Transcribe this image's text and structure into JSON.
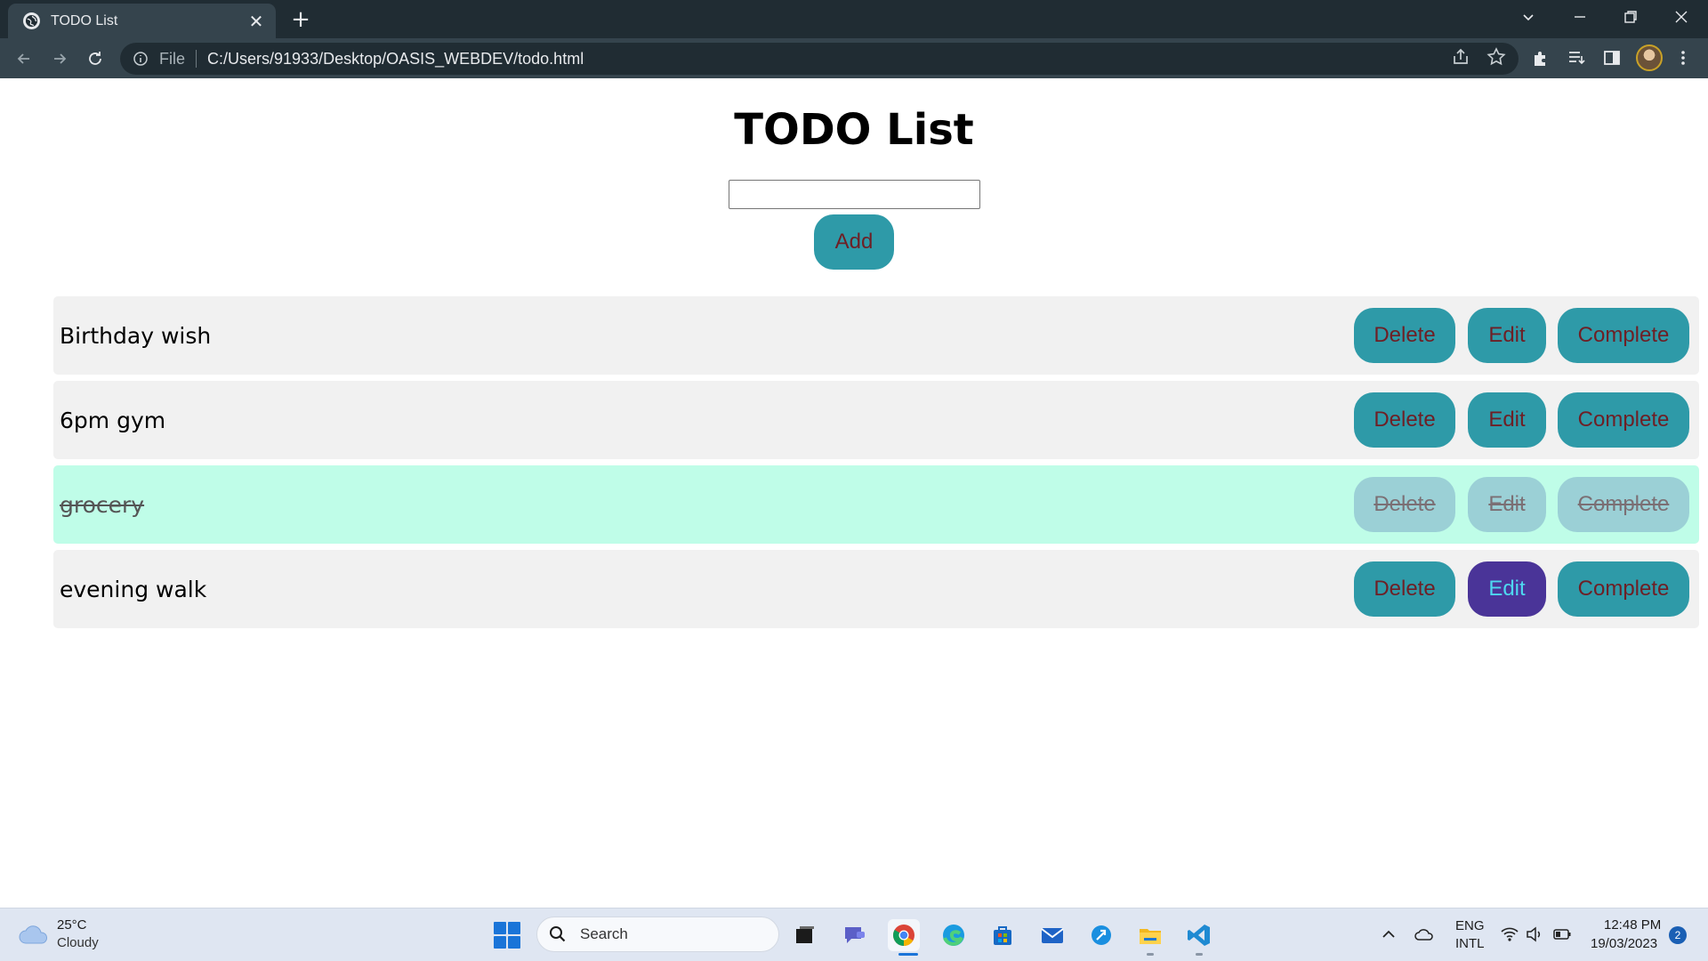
{
  "browser": {
    "tab_title": "TODO List",
    "address_scheme": "File",
    "address_url": "C:/Users/91933/Desktop/OASIS_WEBDEV/todo.html"
  },
  "page": {
    "heading": "TODO List",
    "input_value": "",
    "add_label": "Add",
    "delete_label": "Delete",
    "edit_label": "Edit",
    "complete_label": "Complete",
    "items": [
      {
        "text": "Birthday wish",
        "completed": false
      },
      {
        "text": "6pm gym",
        "completed": false
      },
      {
        "text": "grocery",
        "completed": true
      },
      {
        "text": "evening walk",
        "completed": false
      }
    ]
  },
  "colors": {
    "button_bg": "#2e9aa8",
    "button_text": "#6e1f25",
    "completed_row_bg": "#bffde8",
    "hover_button_bg": "#4a3498"
  },
  "taskbar": {
    "weather_temp": "25°C",
    "weather_desc": "Cloudy",
    "search_label": "Search",
    "lang_line1": "ENG",
    "lang_line2": "INTL",
    "time": "12:48 PM",
    "date": "19/03/2023",
    "notification_count": "2"
  }
}
